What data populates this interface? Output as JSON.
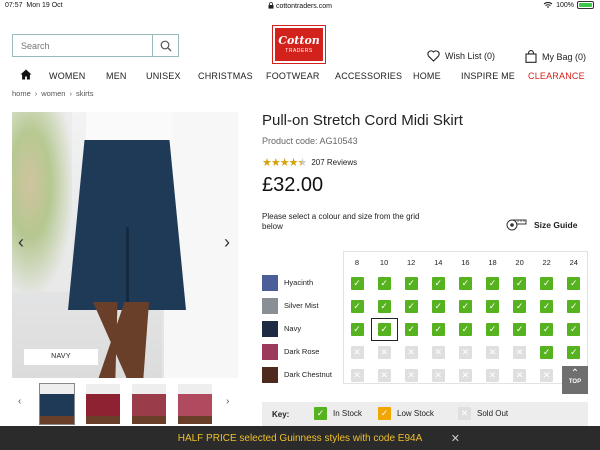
{
  "status_bar": {
    "time": "07:57",
    "date": "Mon 19 Oct",
    "url": "cottontraders.com",
    "battery": "100%",
    "lock_icon": "lock-icon",
    "wifi_icon": "wifi-icon"
  },
  "header": {
    "search_placeholder": "Search",
    "logo_line1": "Cotton",
    "logo_line2": "TRADERS",
    "wishlist_label": "Wish List (0)",
    "bag_label": "My Bag (0)",
    "brand_color": "#d3221c"
  },
  "nav": {
    "items": [
      "WOMEN",
      "MEN",
      "UNISEX",
      "CHRISTMAS",
      "FOOTWEAR",
      "ACCESSORIES",
      "HOME",
      "INSPIRE ME",
      "CLEARANCE"
    ]
  },
  "breadcrumb": [
    "home",
    "women",
    "skirts"
  ],
  "product": {
    "title": "Pull-on Stretch Cord Midi Skirt",
    "code": "Product code: AG10543",
    "rating": 4.5,
    "reviews": "207 Reviews",
    "price": "£32.00",
    "image_color_label": "NAVY",
    "instruction": "Please select a colour and size from the grid below",
    "size_guide": "Size Guide"
  },
  "thumbnails": [
    {
      "color": "#1f3a56"
    },
    {
      "color": "#8e2233"
    },
    {
      "color": "#9a3c4a"
    },
    {
      "color": "#b04a5e"
    }
  ],
  "size_grid": {
    "sizes": [
      "8",
      "10",
      "12",
      "14",
      "16",
      "18",
      "20",
      "22",
      "24"
    ],
    "rows": [
      {
        "name": "Hyacinth",
        "swatch": "#4a5f9a",
        "stock": [
          "in",
          "in",
          "in",
          "in",
          "in",
          "in",
          "in",
          "in",
          "in"
        ]
      },
      {
        "name": "Silver Mist",
        "swatch": "#8a8f96",
        "stock": [
          "in",
          "in",
          "in",
          "in",
          "in",
          "in",
          "in",
          "in",
          "in"
        ]
      },
      {
        "name": "Navy",
        "swatch": "#1c2a44",
        "stock": [
          "in",
          "in",
          "in",
          "in",
          "in",
          "in",
          "in",
          "in",
          "in"
        ]
      },
      {
        "name": "Dark Rose",
        "swatch": "#9c3a5c",
        "stock": [
          "out",
          "out",
          "out",
          "out",
          "out",
          "out",
          "out",
          "in",
          "in"
        ]
      },
      {
        "name": "Dark Chestnut",
        "swatch": "#4e2a1e",
        "stock": [
          "out",
          "out",
          "out",
          "out",
          "out",
          "out",
          "out",
          "out",
          "out"
        ]
      }
    ],
    "selected": {
      "row": 2,
      "col": 1
    }
  },
  "top_button": "TOP",
  "key": {
    "label": "Key:",
    "in_stock": "In Stock",
    "low_stock": "Low Stock",
    "sold_out": "Sold Out"
  },
  "promo": {
    "text": "HALF PRICE selected Guinness styles with code E94A",
    "close": "✕"
  }
}
